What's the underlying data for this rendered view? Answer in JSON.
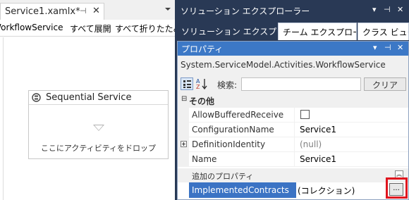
{
  "doc_tab": {
    "title": "Service1.xamlx*",
    "pin": "⊣",
    "close": "✕"
  },
  "breadcrumb": {
    "root": "WorkflowService",
    "expand_all": "すべて展開",
    "collapse_all": "すべて折りたたみ"
  },
  "designer": {
    "activity_title": "Sequential Service",
    "drop_hint": "ここにアクティビティをドロップ"
  },
  "solution_explorer": {
    "title": "ソリューション エクスプローラー",
    "controls": {
      "dropdown": "▾",
      "pin": "⊣",
      "close": "✕"
    },
    "tabs": [
      {
        "label": "ソリューション エクスプロー..."
      },
      {
        "label": "チーム エクスプローラー"
      },
      {
        "label": "クラス ビュー"
      }
    ]
  },
  "properties": {
    "title": "プロパティ",
    "controls": {
      "dropdown": "▾",
      "pin": "⊣",
      "close": "✕"
    },
    "object_name": "System.ServiceModel.Activities.WorkflowService",
    "toolbar": {
      "search_label": "検索:",
      "search_placeholder": "",
      "clear_label": "クリア"
    },
    "category": {
      "toggle": "⊟",
      "label": "その他"
    },
    "rows": [
      {
        "name": "AllowBufferedReceive",
        "value": ""
      },
      {
        "name": "ConfigurationName",
        "value": "Service1"
      },
      {
        "name": "DefinitionIdentity",
        "value": "(null)"
      },
      {
        "name": "Name",
        "value": "Service1"
      }
    ],
    "additional_label": "追加のプロパティ",
    "selected": {
      "name": "ImplementedContracts",
      "value": "(コレクション)",
      "button": "..."
    }
  },
  "colors": {
    "ide_dark": "#293955",
    "selection": "#3b73c4",
    "highlight": "#e0141e"
  }
}
